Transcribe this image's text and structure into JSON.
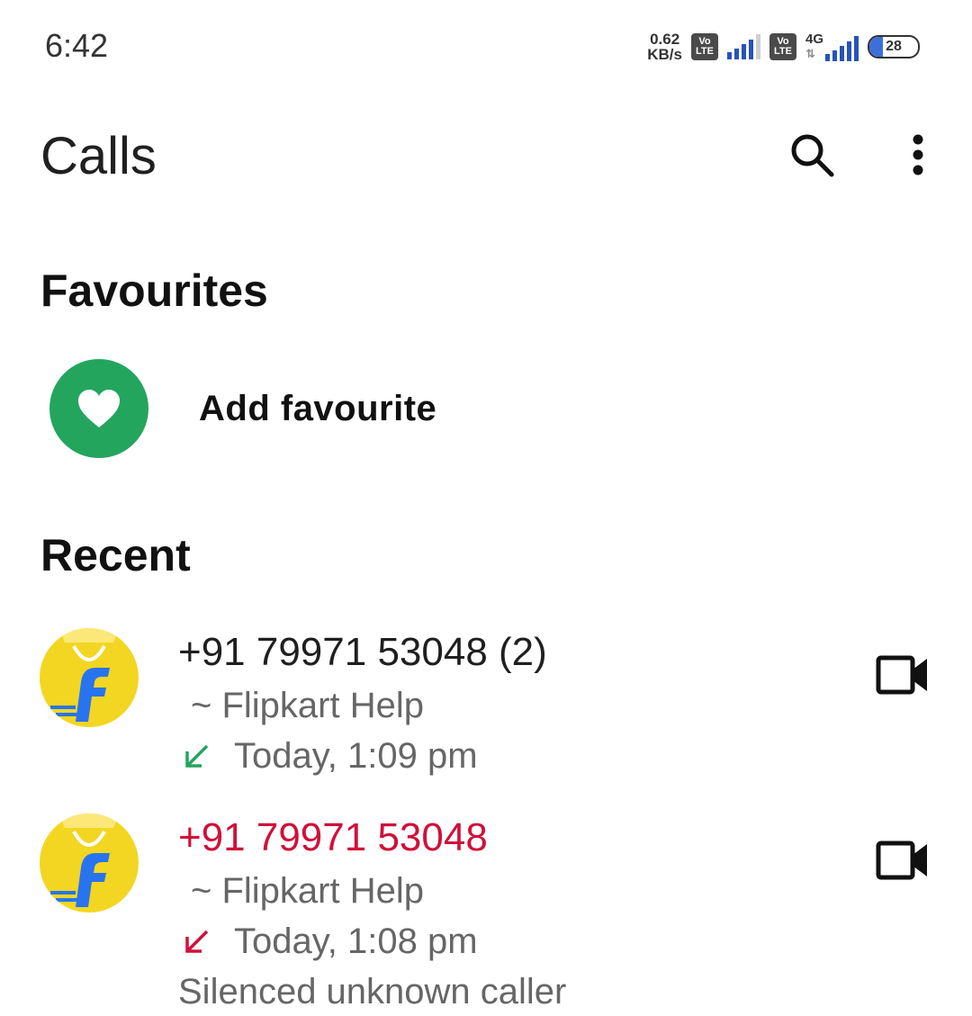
{
  "status_bar": {
    "time": "6:42",
    "net_speed_value": "0.62",
    "net_speed_unit": "KB/s",
    "volte_top": "Vo",
    "volte_bottom": "LTE",
    "network_type": "4G",
    "battery_level": "28"
  },
  "header": {
    "title": "Calls",
    "search_icon": "search-icon",
    "more_icon": "more-vert-icon"
  },
  "favourites": {
    "title": "Favourites",
    "add_label": "Add favourite",
    "icon": "heart-icon",
    "accent_color": "#24a55e"
  },
  "recent": {
    "title": "Recent",
    "items": [
      {
        "number": "+91 79971 53048",
        "count": "(2)",
        "name": "~ Flipkart Help",
        "time": "Today, 1:09 pm",
        "call_type": "incoming",
        "arrow_color": "#24a55e",
        "note": ""
      },
      {
        "number": "+91 79971 53048",
        "count": "",
        "name": "~ Flipkart Help",
        "time": "Today, 1:08 pm",
        "call_type": "missed",
        "arrow_color": "#d0103a",
        "note": "Silenced unknown caller"
      }
    ]
  },
  "colors": {
    "missed": "#d0103a",
    "incoming": "#24a55e",
    "signal": "#2753b8"
  }
}
